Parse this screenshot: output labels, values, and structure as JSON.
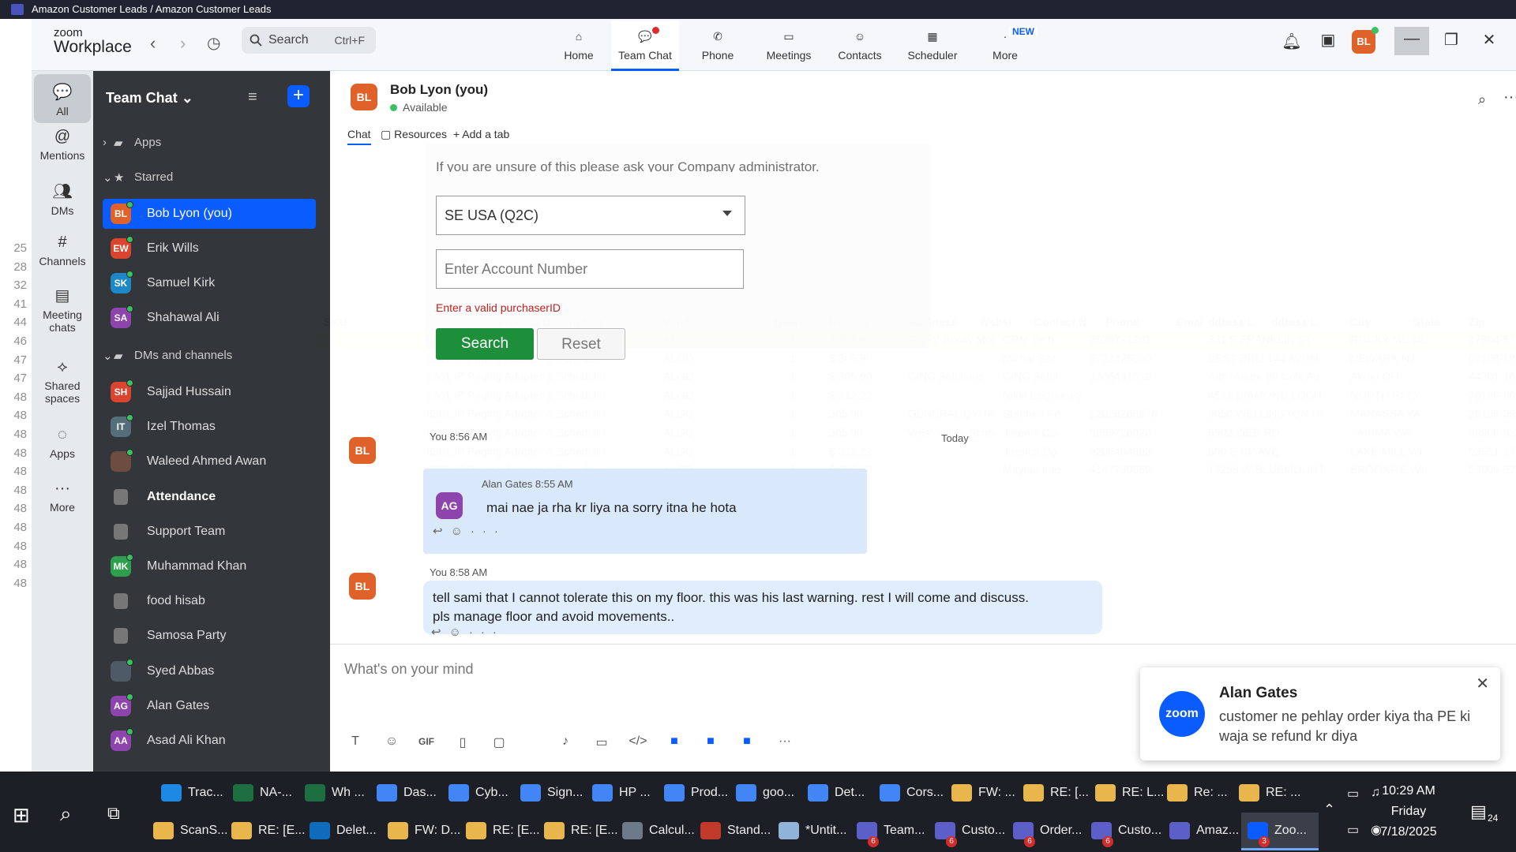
{
  "excel": {
    "window_title": "Amazon Customer Leads / Amazon Customer Leads",
    "row_numbers": [
      "25",
      "28",
      "32",
      "41",
      "44",
      "46",
      "47",
      "47",
      "48",
      "48",
      "48",
      "48",
      "48",
      "48",
      "48",
      "48",
      "48",
      "48",
      "48"
    ],
    "columns": [
      "SKU",
      "Product Description",
      "Vendor",
      "Quanti",
      "Revenu",
      "Business",
      "Websi",
      "Contact N",
      "Phone",
      "Emai",
      "ddress L",
      "ddress L",
      "City",
      "State",
      "Zip"
    ],
    "rows": [
      [
        "8301 IP Paging Adapter & Scheduler",
        "ALGO",
        "1",
        "$ 305.90",
        "City of Rocky Mount",
        "CRM Tech",
        "2529721201",
        "331 S FRANKLIN ST",
        "ROCKY MC NC",
        "27804-5712"
      ],
      [
        "8301 IP Paging Adapter & Scheduler",
        "ALGO",
        "1",
        "$ 305.90",
        "",
        "Michal Szc",
        "9732425000",
        "BEST PRO 144 AVON",
        "NEWARK NJ",
        "07108-1906"
      ],
      [
        "8301 IP Paging Adapter & Scheduler",
        "ALGO",
        "1",
        "$ 305.90",
        "CINC Solutions",
        "CINC Solut",
        "3306441519",
        "Attn: Andre 80 Cole Av",
        "Akron OH",
        "44301-1605"
      ],
      [
        "8301 IP Paging Adapter & Scheduler",
        "ALGO",
        "1",
        "$ 312.22",
        "",
        "Nikki Laigreen SG",
        "",
        "4521 DIAMOND LOCH",
        "NORTH RI TX",
        "76180-8075"
      ],
      [
        "8301 IP Paging Adapter & Scheduler",
        "ALGO",
        "1",
        "305.90",
        "GENERAL DYNAMICS",
        "Stephen Pe",
        "12028266576",
        "9050 WELLINGTON RI",
        "MANASSA VA",
        "20109-3920"
      ],
      [
        "8301 IP Paging Adapter & Scheduler",
        "ALGO",
        "1",
        "305.90",
        "West Valley School Dist",
        "Jeremy Coi",
        "5099726020",
        "6902 ZIER RD",
        "YAKIMA WA",
        "98908-9240"
      ],
      [
        "8301 IP Paging Adapter & Scheduler",
        "ALGO",
        "1",
        "$ 312.22",
        "",
        "Jessica Do",
        "9206464853",
        "500 S CP AVE",
        "LAKE MILL WI",
        "53551-1758"
      ],
      [
        "8301 IP Paging Adapter & Scheduler",
        "ALGO",
        "1",
        "$ 305.90",
        "",
        "Mayfair Inte",
        "4147730659",
        "13255 W BLUEMOUNT",
        "BROOKFIE WI",
        "53005-6245"
      ]
    ]
  },
  "zoom": {
    "logo_line1": "zoom",
    "logo_line2": "Workplace",
    "search": {
      "label": "Search",
      "shortcut": "Ctrl+F"
    },
    "nav_tabs": [
      {
        "label": "Home"
      },
      {
        "label": "Team Chat"
      },
      {
        "label": "Phone"
      },
      {
        "label": "Meetings"
      },
      {
        "label": "Contacts"
      },
      {
        "label": "Scheduler"
      },
      {
        "label": "More",
        "badge": "NEW"
      }
    ],
    "user_initials": "BL",
    "rail": [
      {
        "label": "All"
      },
      {
        "label": "Mentions"
      },
      {
        "label": "DMs"
      },
      {
        "label": "Channels"
      },
      {
        "label": "Meeting chats"
      },
      {
        "label": "Shared spaces"
      },
      {
        "label": "Apps"
      },
      {
        "label": "More"
      }
    ],
    "sidebar": {
      "title": "Team Chat",
      "apps_label": "Apps",
      "starred_label": "Starred",
      "dms_channels_label": "DMs and channels",
      "starred": [
        {
          "name": "Bob Lyon (you)",
          "initials": "BL",
          "color": "#e0622b"
        },
        {
          "name": "Erik Wills",
          "initials": "EW",
          "color": "#d9452f"
        },
        {
          "name": "Samuel Kirk",
          "initials": "SK",
          "color": "#1e88c7"
        },
        {
          "name": "Shahawal Ali",
          "initials": "SA",
          "color": "#8e44ad"
        }
      ],
      "channels": [
        {
          "name": "Sajjad Hussain",
          "initials": "SH",
          "color": "#d9452f"
        },
        {
          "name": "Izel Thomas",
          "initials": "IT",
          "color": "#546e7a"
        },
        {
          "name": "Waleed Ahmed Awan",
          "initials": "",
          "color": "#6d4c41"
        },
        {
          "name": "Attendance",
          "initials": "",
          "color": "",
          "lock": true,
          "bold": true
        },
        {
          "name": "Support Team",
          "initials": "",
          "color": "",
          "lock": true
        },
        {
          "name": "Muhammad Khan",
          "initials": "MK",
          "color": "#2e9e4f"
        },
        {
          "name": "food hisab",
          "initials": "",
          "color": "",
          "lock": true
        },
        {
          "name": "Samosa Party",
          "initials": "",
          "color": "",
          "lock": true
        },
        {
          "name": "Syed Abbas",
          "initials": "",
          "color": "#4e5b66"
        },
        {
          "name": "Alan Gates",
          "initials": "AG",
          "color": "#8e44ad"
        },
        {
          "name": "Asad Ali Khan",
          "initials": "AA",
          "color": "#8e44ad"
        }
      ]
    },
    "chat": {
      "contact_name": "Bob Lyon (you)",
      "contact_status": "Available",
      "contact_initials": "BL",
      "tabs": [
        "Chat",
        "Resources",
        "Add a tab"
      ],
      "today": "Today",
      "form": {
        "hint": "If you are unsure of this please ask your Company administrator.",
        "region": "SE USA (Q2C)",
        "account_placeholder": "Enter Account Number",
        "error": "Enter a valid purchaserID",
        "search_label": "Search",
        "reset_label": "Reset"
      },
      "messages": [
        {
          "meta": "You 8:56 AM",
          "initials": "BL",
          "quote_author": "Alan Gates 8:55 AM",
          "quote_initials": "AG",
          "quote_text": "mai nae ja rha kr liya na sorry itna he hota"
        },
        {
          "meta": "You 8:58 AM",
          "initials": "BL",
          "text_line1": "tell sami that I cannot tolerate this on my floor. this was his last warning. rest I will come and discuss.",
          "text_line2": "pls manage floor and avoid movements.."
        }
      ],
      "composer_placeholder": "What's on your mind",
      "gif_label": "GIF"
    },
    "toast": {
      "logo": "zoom",
      "name": "Alan Gates",
      "text": "customer ne pehlay order kiya tha PE ki waja se refund kr diya"
    }
  },
  "taskbar": {
    "row1": [
      "Trac...",
      "NA-...",
      "Wh ...",
      "Das...",
      "Cyb...",
      "Sign...",
      "HP ...",
      "Prod...",
      "goo...",
      "Det...",
      "Cors...",
      "FW: ...",
      "RE: [...",
      "RE: L...",
      "Re: ...",
      "RE: ..."
    ],
    "row2": [
      "ScanS...",
      "RE: [E...",
      "Delet...",
      "FW: D...",
      "RE: [E...",
      "RE: [E...",
      "Calcul...",
      "Stand...",
      "*Untit...",
      "Team...",
      "Custo...",
      "Order...",
      "Custo...",
      "Amaz...",
      "Zoo..."
    ],
    "badges": {
      "team": "6",
      "custo1": "6",
      "order": "6",
      "custo2": "6",
      "zoom": "3"
    },
    "time": "10:29 AM",
    "day": "Friday",
    "date": "7/18/2025",
    "notifications": "24"
  }
}
